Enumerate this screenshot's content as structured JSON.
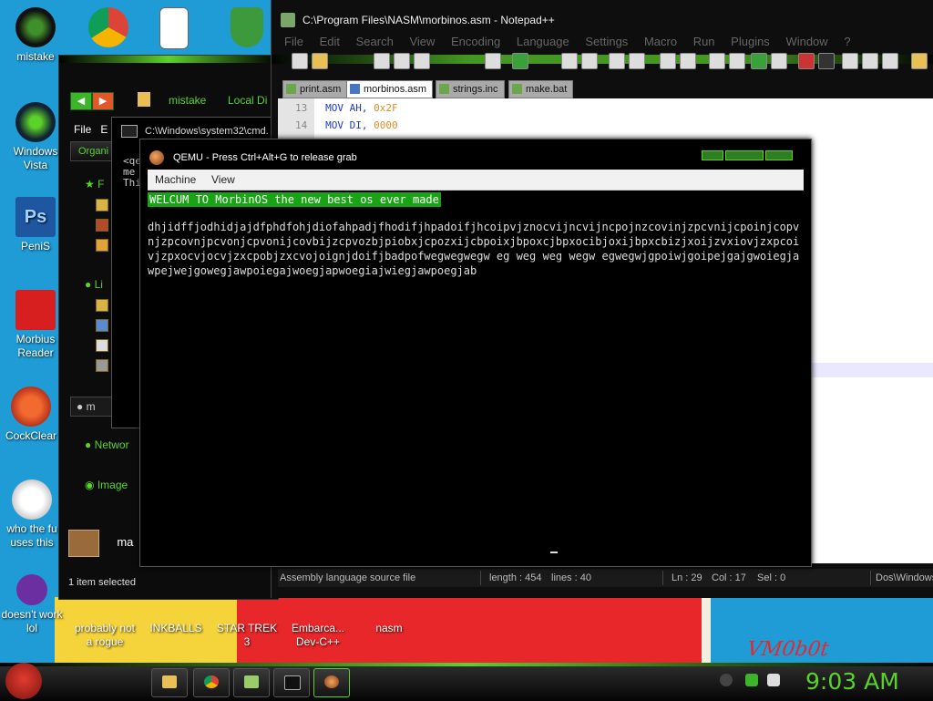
{
  "desktop": {
    "icons": [
      {
        "label": "mistake",
        "color": "#1c1c1c"
      },
      {
        "label": "Windows Vista",
        "color": "#2e7d32"
      },
      {
        "label": "PeniS",
        "color": "#1e56a0"
      },
      {
        "label": "Morbius Reader",
        "color": "#d71f1f"
      },
      {
        "label": "CockClear",
        "color": "#d84a1b"
      },
      {
        "label": "who the fu uses this",
        "color": "#f0f0f0"
      },
      {
        "label": "doesn't work lol",
        "color": "#6b2fa1"
      },
      {
        "label": "probably not a rogue",
        "color": "#3b6fd1"
      },
      {
        "label": "INKBALLS",
        "color": "#e0443a"
      },
      {
        "label": "STAR TREK 3",
        "color": "#222222"
      },
      {
        "label": "Embarca... Dev-C++",
        "color": "#b82323"
      },
      {
        "label": "nasm",
        "color": "#2255aa"
      }
    ],
    "wallpaper_sign": "VM0b0t"
  },
  "explorer": {
    "title": "mistake",
    "path_fragment": "Local Di",
    "menu_file": "File",
    "menu_edit": "E",
    "organize": "Organi",
    "side_favorites": "F",
    "side_libraries": "Li",
    "side_item": "m",
    "side_network": "Networ",
    "side_image": "Image",
    "bottom_item": "ma",
    "status": "1 item selected"
  },
  "cmd": {
    "title": "C:\\Windows\\system32\\cmd.",
    "text": "<qe\nme\nThi"
  },
  "notepad": {
    "title": "C:\\Program Files\\NASM\\morbinos.asm - Notepad++",
    "menu": [
      "File",
      "Edit",
      "Search",
      "View",
      "Encoding",
      "Language",
      "Settings",
      "Macro",
      "Run",
      "Plugins",
      "Window",
      "?"
    ],
    "tabs": [
      "print.asm",
      "morbinos.asm",
      "strings.inc",
      "make.bat"
    ],
    "code": [
      {
        "line": "13",
        "kw": "MOV",
        "reg": "AH,",
        "num": "0x2F"
      },
      {
        "line": "14",
        "kw": "MOV",
        "reg": "DI,",
        "num": "0000"
      }
    ],
    "status": {
      "type": "Assembly language source file",
      "length": "length : 454",
      "lines": "lines : 40",
      "ln": "Ln : 29",
      "col": "Col : 17",
      "sel": "Sel : 0",
      "eol": "Dos\\Windows"
    }
  },
  "qemu": {
    "title": "QEMU - Press Ctrl+Alt+G to release grab",
    "menu_machine": "Machine",
    "menu_view": "View",
    "welcome": "WELCUM TO MorbinOS the new best os ever made",
    "junk": "dhjidffjodhidjajdfphdfohjdiofahpadjfhodifjhpadoifjhcoipvjznocvijncvijncpojnzcovinjzpcvnijcpoinjcopvnjzpcovnjpcvonjcpvonijcovbijzcpvozbjpiobxjcpozxijcbpoixjbpoxcjbpxocibjoxijbpxcbizjxoijzvxiovjzxpcoivjzpxocvjocvjzxcpobjzxcvojoignjdoifjbadpofwegwegwegw eg weg weg wegw egwegwjgpoiwjgoipejgajgwoiegjawpejwejgowegjawpoiegajwoegjapwoegiajwiegjawpoegjab"
  },
  "taskbar": {
    "clock": "9:03 AM",
    "buttons": [
      "explorer",
      "chrome",
      "notepad++",
      "cmd",
      "qemu"
    ],
    "accent": "#5bd22a"
  }
}
